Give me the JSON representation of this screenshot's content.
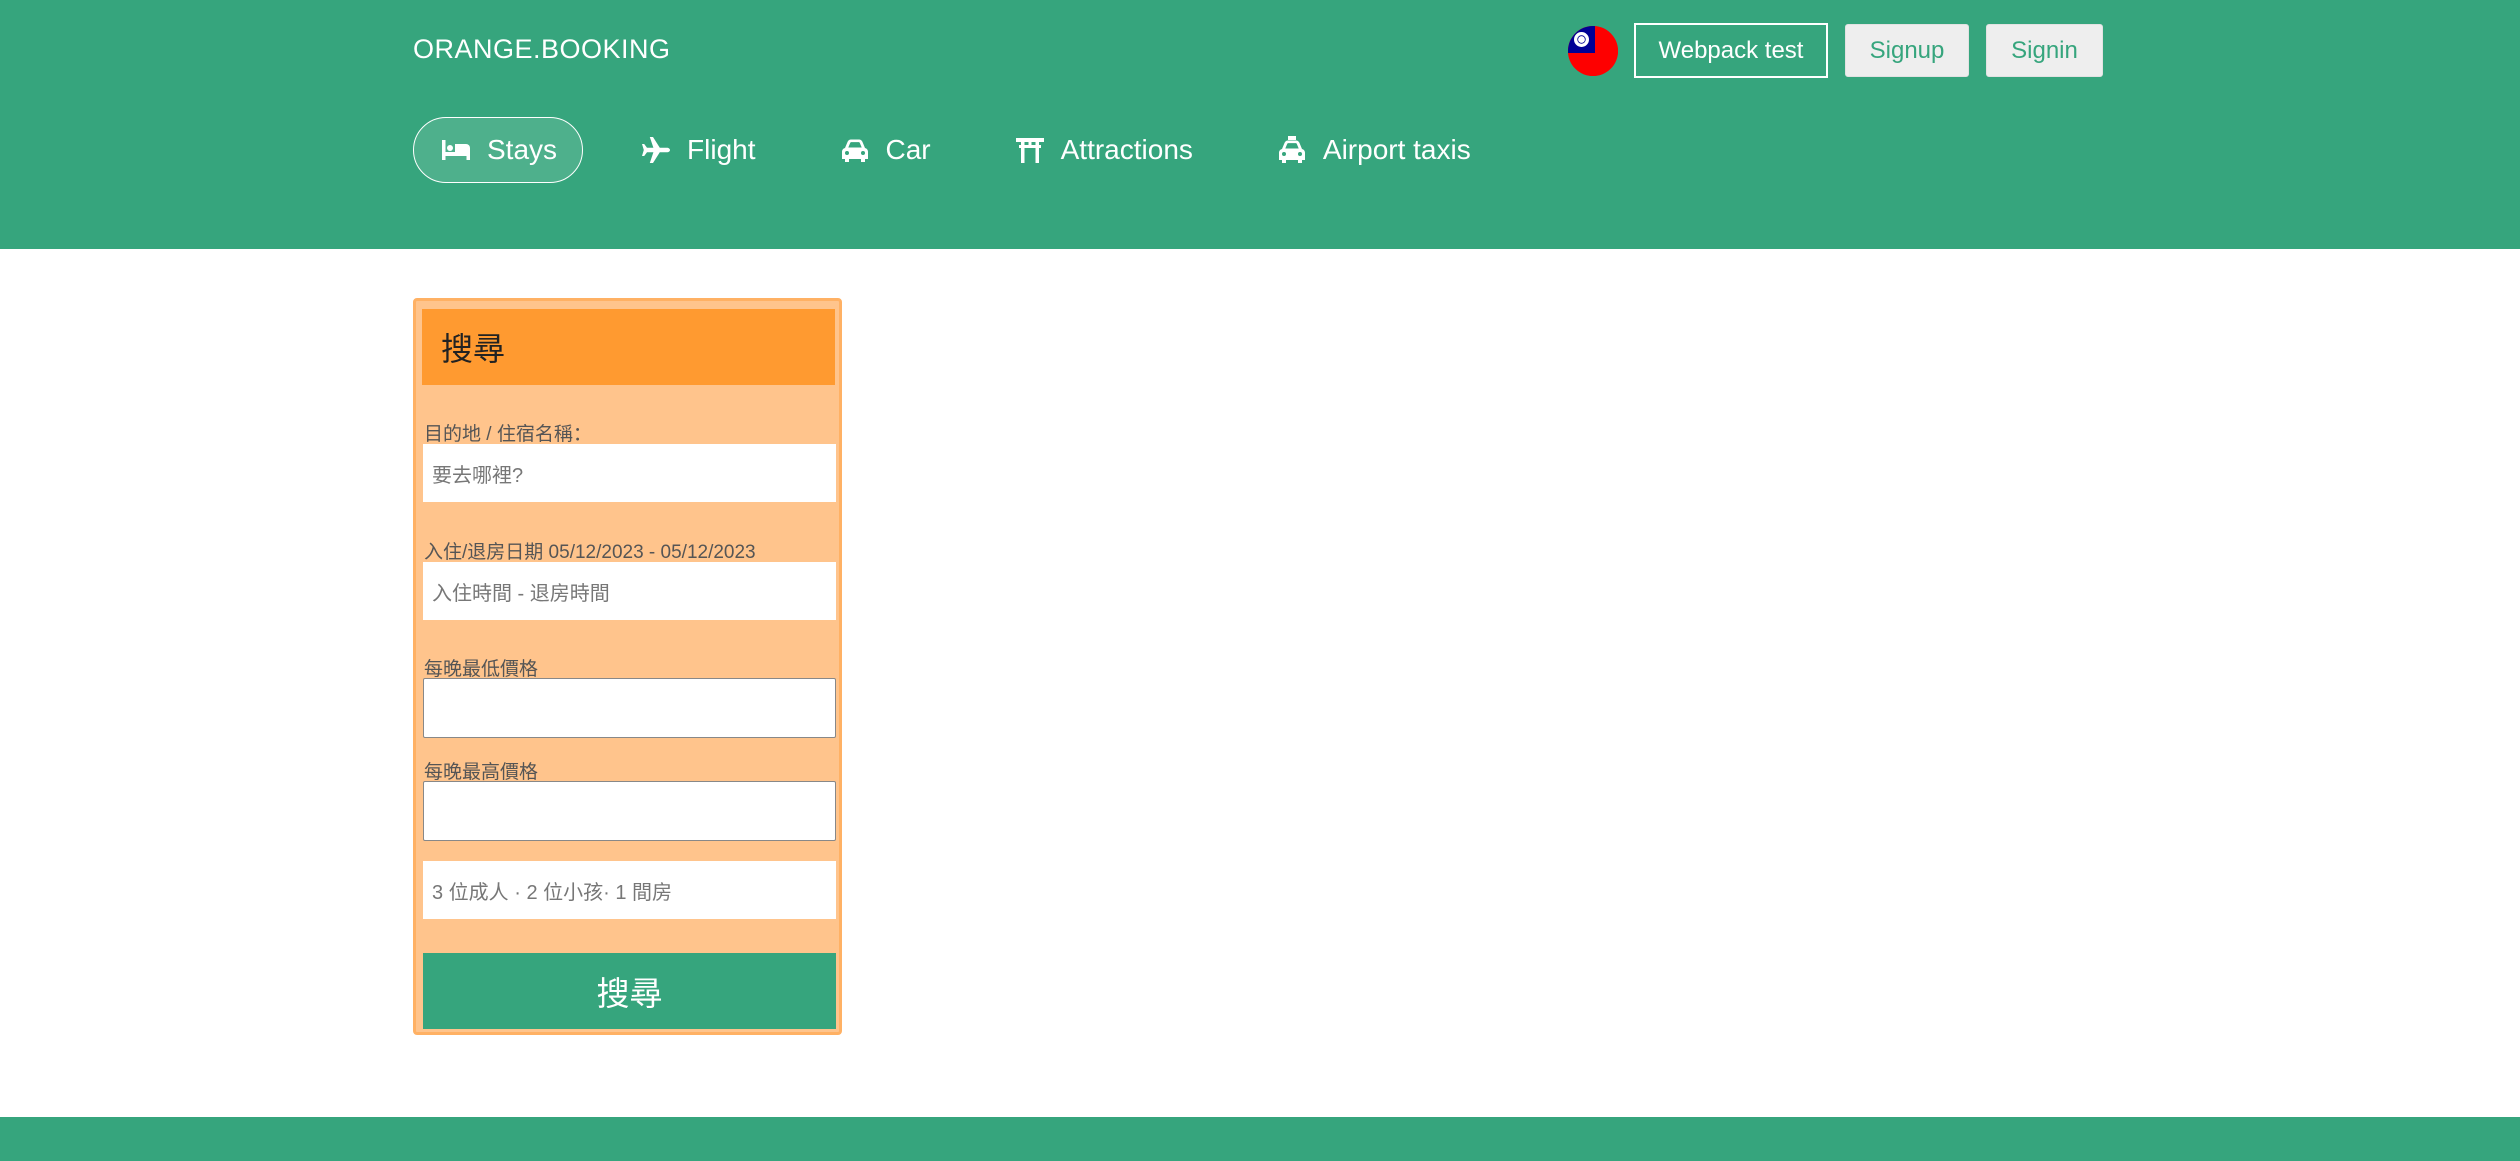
{
  "header": {
    "logo": "ORANGE.BOOKING",
    "flag_icon": "taiwan-flag-icon",
    "buttons": {
      "webpack": "Webpack test",
      "signup": "Signup",
      "signin": "Signin"
    },
    "nav": [
      {
        "label": "Stays",
        "icon": "bed-icon",
        "active": true
      },
      {
        "label": "Flight",
        "icon": "plane-icon",
        "active": false
      },
      {
        "label": "Car",
        "icon": "car-icon",
        "active": false
      },
      {
        "label": "Attractions",
        "icon": "torii-gate-icon",
        "active": false
      },
      {
        "label": "Airport taxis",
        "icon": "taxi-icon",
        "active": false
      }
    ]
  },
  "search": {
    "title": "搜尋",
    "destination_label": "目的地 / 住宿名稱：",
    "destination_placeholder": "要去哪裡?",
    "dates_label": "入住/退房日期 05/12/2023 - 05/12/2023",
    "dates_placeholder": "入住時間 - 退房時間",
    "min_price_label": "每晚最低價格",
    "min_price_value": "",
    "max_price_label": "每晚最高價格",
    "max_price_value": "",
    "guests_summary": "3 位成人 · 2 位小孩· 1 間房",
    "submit_label": "搜尋"
  },
  "colors": {
    "brand_green": "#36a57d",
    "orange_header": "#ff9a30",
    "orange_panel": "#ffc48c"
  }
}
